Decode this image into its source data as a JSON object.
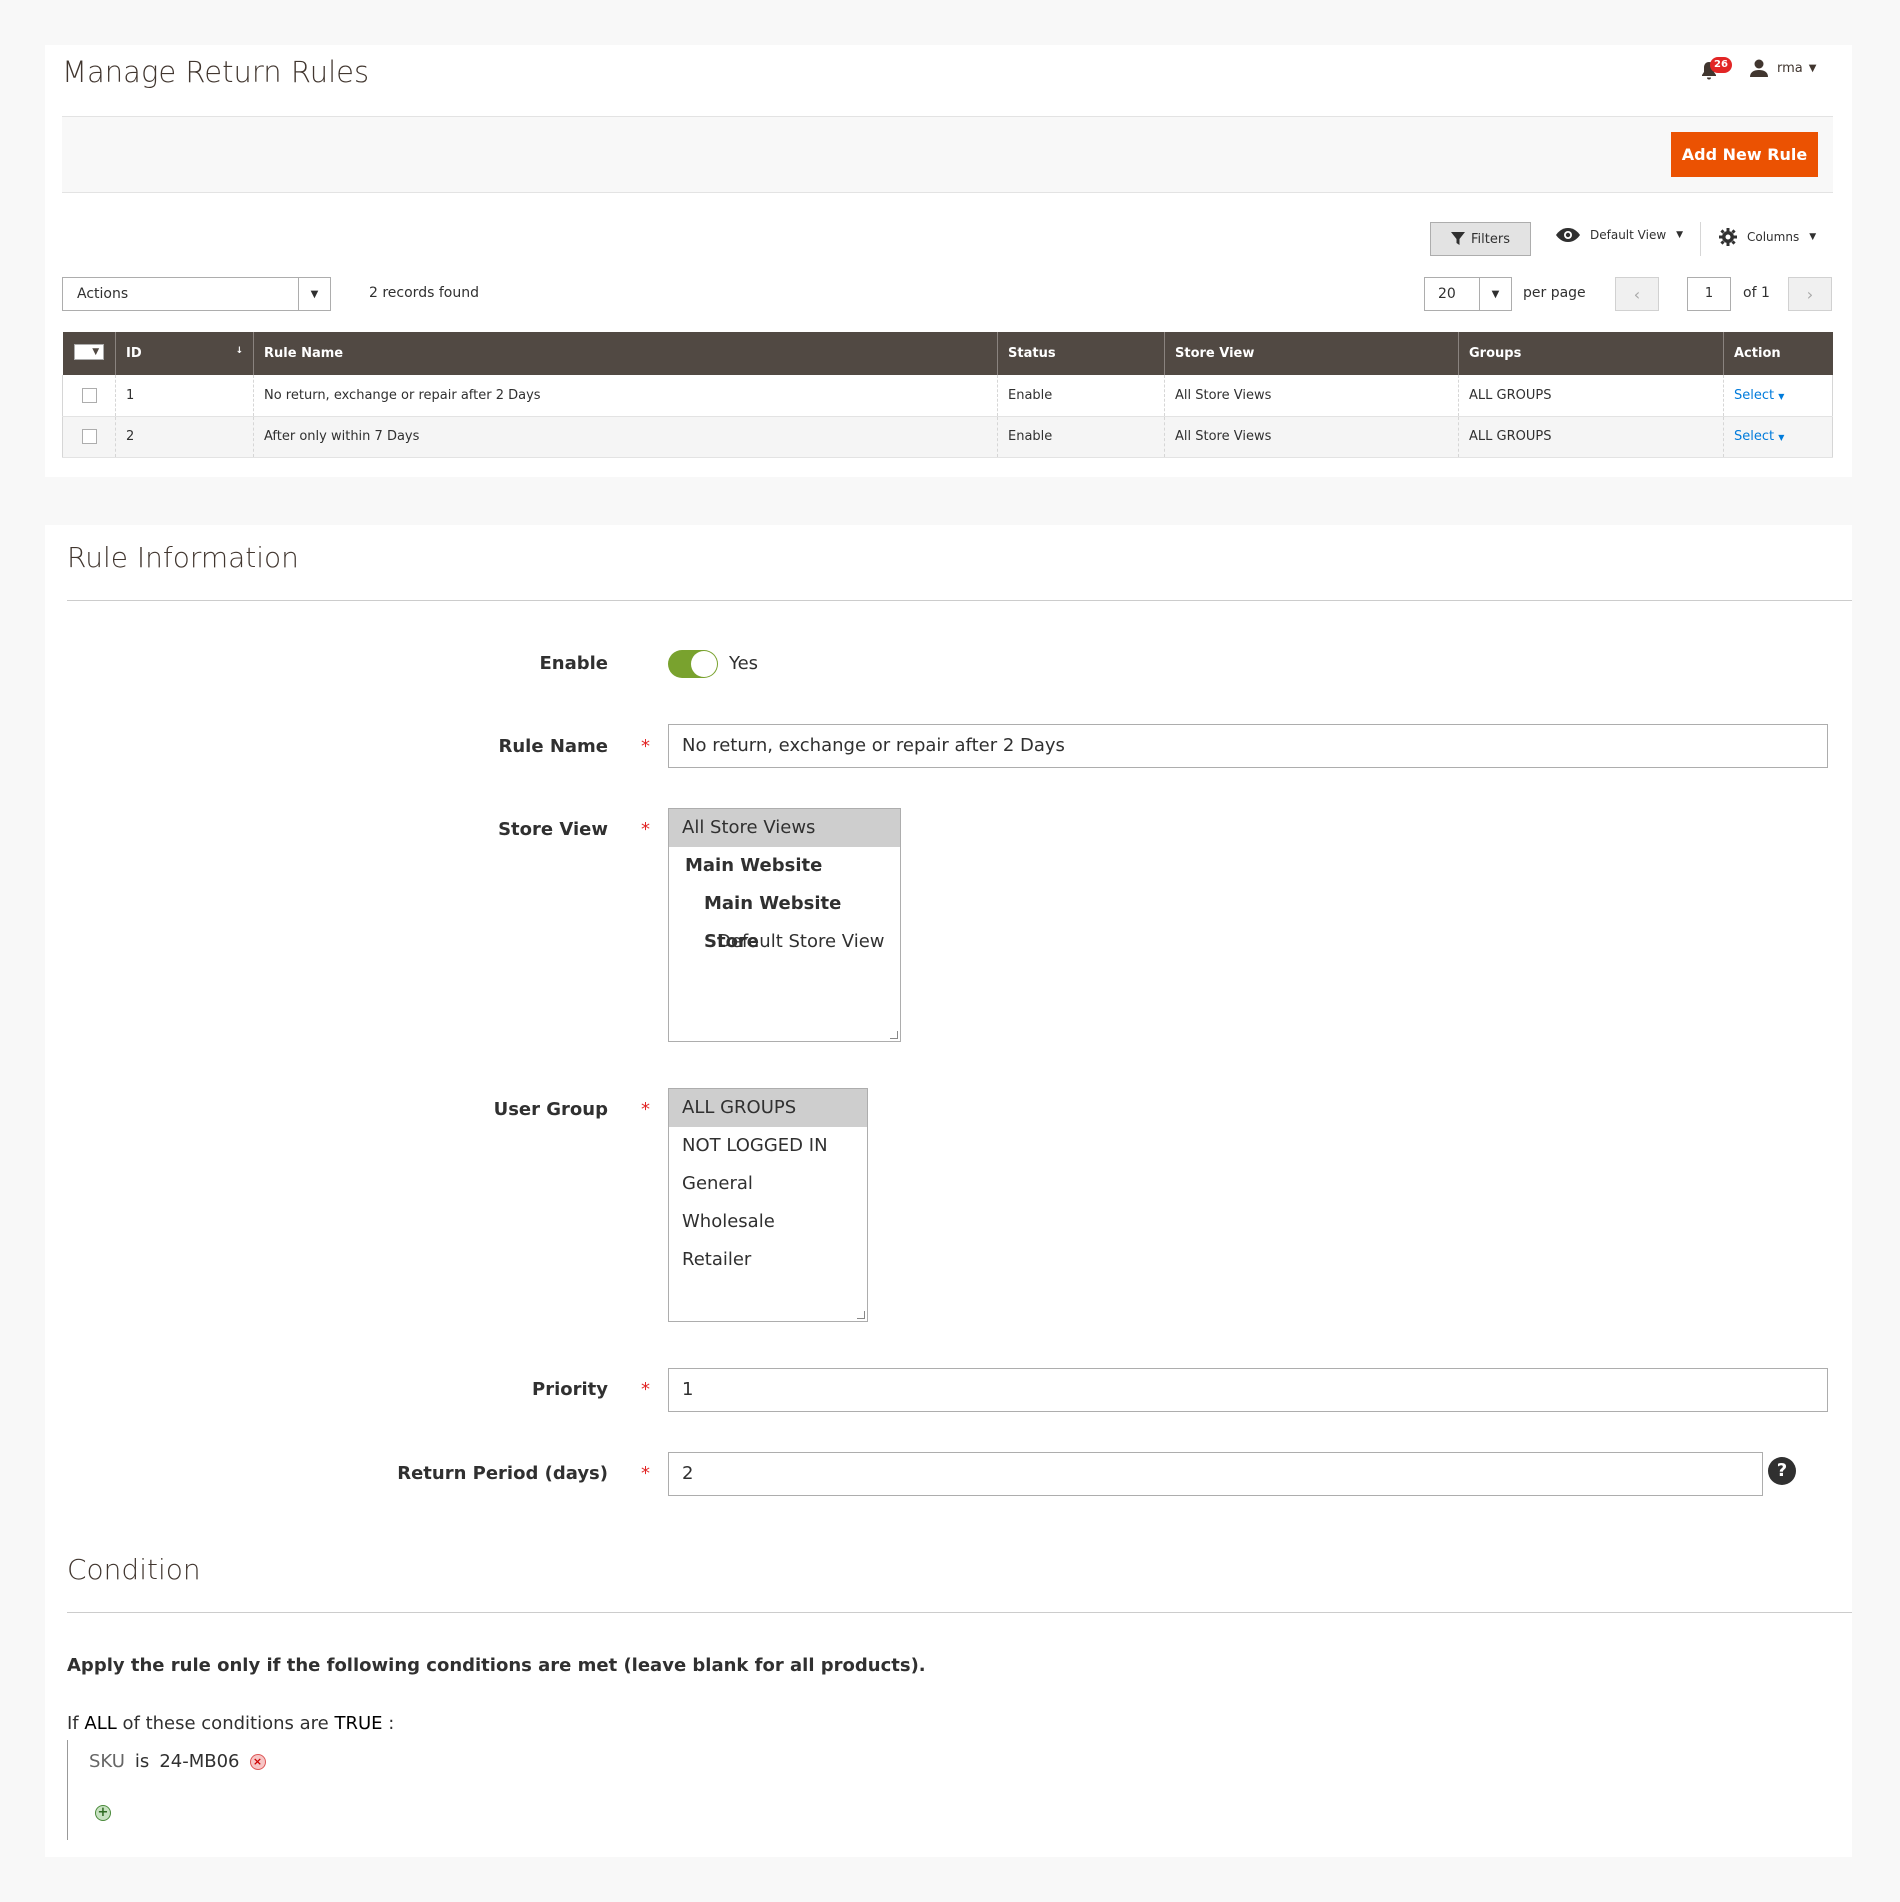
{
  "header": {
    "title": "Manage Return Rules",
    "notifications_count": "26",
    "user_name": "rma"
  },
  "toolbar": {
    "add_new_label": "Add New Rule",
    "filters_label": "Filters",
    "view_label": "Default View",
    "columns_label": "Columns",
    "actions_label": "Actions",
    "records_found": "2 records found",
    "per_page_value": "20",
    "per_page_label": "per page",
    "page_value": "1",
    "page_of": "of 1"
  },
  "grid": {
    "columns": [
      "ID",
      "Rule Name",
      "Status",
      "Store View",
      "Groups",
      "Action"
    ],
    "rows": [
      {
        "id": "1",
        "name": "No return, exchange or repair after 2 Days",
        "status": "Enable",
        "store_view": "All Store Views",
        "groups": "ALL GROUPS",
        "action": "Select"
      },
      {
        "id": "2",
        "name": "After only within 7 Days",
        "status": "Enable",
        "store_view": "All Store Views",
        "groups": "ALL GROUPS",
        "action": "Select"
      }
    ]
  },
  "rule_info": {
    "section_title": "Rule Information",
    "enable_label": "Enable",
    "enable_value": "Yes",
    "rule_name_label": "Rule Name",
    "rule_name_value": "No return, exchange or repair after 2 Days",
    "store_view_label": "Store View",
    "store_view_options": [
      "All Store Views",
      "Main Website",
      "Main Website Store",
      "Default Store View"
    ],
    "user_group_label": "User Group",
    "user_group_options": [
      "ALL GROUPS",
      "NOT LOGGED IN",
      "General",
      "Wholesale",
      "Retailer"
    ],
    "priority_label": "Priority",
    "priority_value": "1",
    "return_period_label": "Return Period (days)",
    "return_period_value": "2",
    "required_mark": "*"
  },
  "condition": {
    "section_title": "Condition",
    "note": "Apply the rule only if the following conditions are met (leave blank for all products).",
    "if_text": "If",
    "aggregator": "ALL",
    "middle_text": "of these conditions are",
    "value": "TRUE",
    "colon": ":",
    "item_attribute": "SKU",
    "item_operator": "is",
    "item_value": "24-MB06"
  },
  "colors": {
    "accent": "#eb5202",
    "grid_header": "#514943",
    "toggle_on": "#79a22e",
    "link": "#007bdb"
  }
}
